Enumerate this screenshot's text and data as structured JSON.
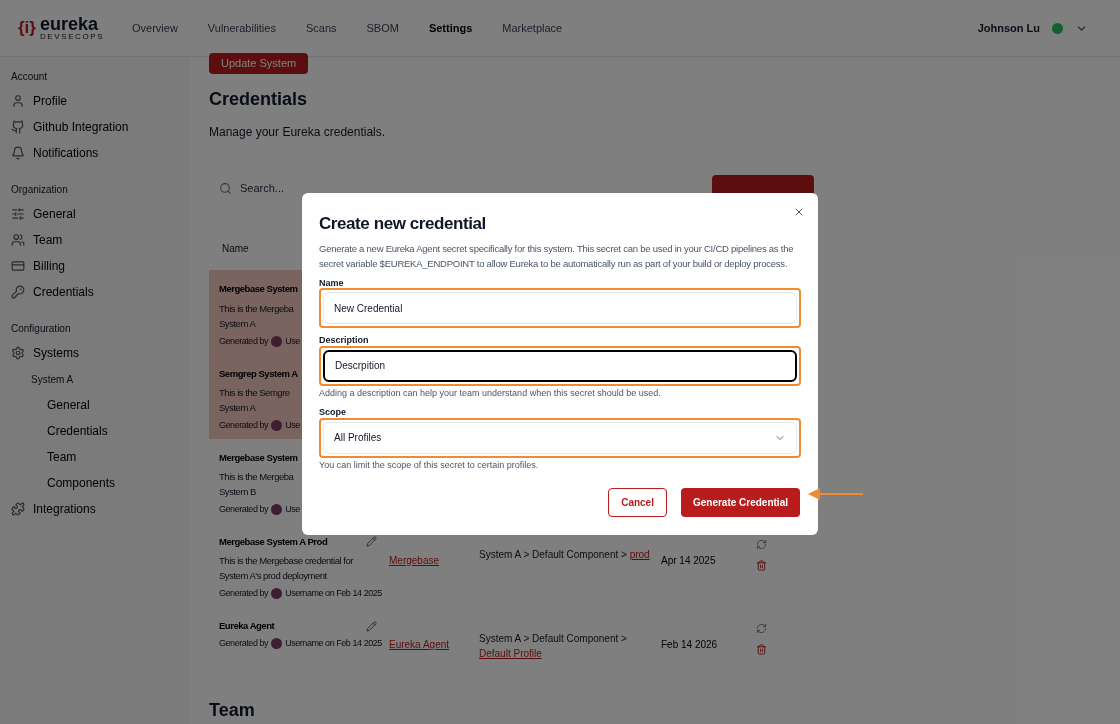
{
  "header": {
    "logo": {
      "mark": "{i}",
      "name": "eureka",
      "tagline": "DEVSECOPS"
    },
    "nav": [
      {
        "label": "Overview",
        "selected": false
      },
      {
        "label": "Vulnerabilities",
        "selected": false
      },
      {
        "label": "Scans",
        "selected": false
      },
      {
        "label": "SBOM",
        "selected": false
      },
      {
        "label": "Settings",
        "selected": true
      },
      {
        "label": "Marketplace",
        "selected": false
      }
    ],
    "user": {
      "name": "Johnson Lu"
    }
  },
  "sidebar": {
    "sections": [
      {
        "title": "Account",
        "items": [
          {
            "label": "Profile"
          },
          {
            "label": "Github Integration"
          },
          {
            "label": "Notifications"
          }
        ]
      },
      {
        "title": "Organization",
        "items": [
          {
            "label": "General"
          },
          {
            "label": "Team"
          },
          {
            "label": "Billing"
          },
          {
            "label": "Credentials"
          }
        ]
      },
      {
        "title": "Configuration",
        "items": [
          {
            "label": "Systems",
            "children": [
              {
                "label": "System A",
                "children": [
                  {
                    "label": "General"
                  },
                  {
                    "label": "Credentials"
                  },
                  {
                    "label": "Team"
                  },
                  {
                    "label": "Components"
                  }
                ]
              }
            ]
          },
          {
            "label": "Integrations"
          }
        ]
      }
    ]
  },
  "main": {
    "update_button": "Update System",
    "title": "Credentials",
    "subtitle": "Manage your Eureka credentials.",
    "search": {
      "placeholder": "Search..."
    },
    "table": {
      "columns": [
        "Name"
      ],
      "rows": [
        {
          "name": "Mergebase System",
          "description": [
            "This is the Mergeba",
            "System A"
          ],
          "generated_by": "Generated by",
          "author": "Use",
          "highlighted": true
        },
        {
          "name": "Semgrep System A",
          "description": [
            "This is the Semgre",
            "System A"
          ],
          "generated_by": "Generated by",
          "author": "Use",
          "highlighted": true
        },
        {
          "name": "Mergebase System",
          "description": [
            "This is the Mergeba",
            "System B"
          ],
          "generated_by": "Generated by",
          "author": "Use",
          "highlighted": false
        },
        {
          "name": "Mergebase System A Prod",
          "description": [
            "This is the Mergebase credential for",
            "System A's prod deployment"
          ],
          "generated_by": "Generated by",
          "author": "Username on Feb 14 2025",
          "highlighted": false,
          "type": "Mergebase",
          "scope": "System A > Default Component >",
          "scope_link": "prod",
          "date": "Apr 14 2025"
        },
        {
          "name": "Eureka Agent",
          "description": [],
          "generated_by": "Generated by",
          "author": "Username on Feb 14 2025",
          "highlighted": false,
          "type": "Eureka Agent",
          "scope": "System A > Default Component >",
          "scope_link": "Default Profile",
          "date": "Feb 14 2026"
        }
      ]
    },
    "next_section": "Team"
  },
  "dialog": {
    "title": "Create new credential",
    "intro": "Generate a new Eureka Agent secret specifically for this system. This secret can be used in your CI/CD pipelines as the secret variable $EUREKA_ENDPOINT to allow Eureka to be automatically run as part of your build or deploy process.",
    "fields": [
      {
        "kind": "text",
        "label": "Name",
        "value": "New Credential",
        "focused": false,
        "highlighted": true
      },
      {
        "kind": "text",
        "label": "Description",
        "value": "Descrpition",
        "focused": true,
        "highlighted": true,
        "help": "Adding a description can help your team understand when this secret should be used."
      },
      {
        "kind": "select",
        "label": "Scope",
        "value": "All Profiles",
        "focused": false,
        "highlighted": true,
        "help": "You can limit the scope of this secret to certain profiles."
      }
    ],
    "cancel": "Cancel",
    "submit": "Generate Credential",
    "submit_pointer": true
  }
}
